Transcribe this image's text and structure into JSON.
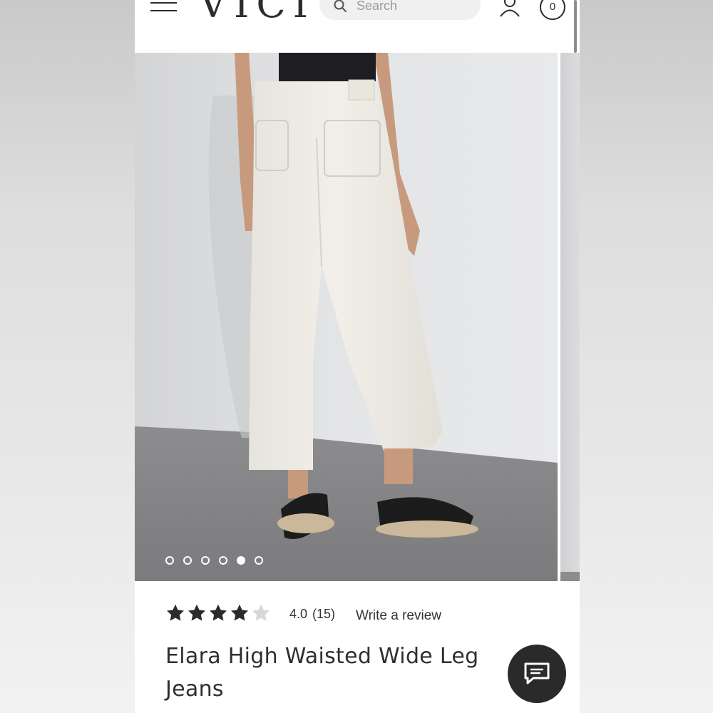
{
  "header": {
    "logo": "VICI",
    "search": {
      "placeholder": "Search"
    },
    "cart_count": "0"
  },
  "gallery": {
    "slide_count": 6,
    "active_slide": 5
  },
  "product": {
    "rating": 4.0,
    "rating_display": "4.0",
    "review_count_display": "(15)",
    "write_review_label": "Write a review",
    "title": "Elara High Waisted Wide Leg Jeans"
  },
  "colors": {
    "text": "#2f2f2f",
    "chat_button": "#2a2a2a",
    "star_filled": "#2b2b2b",
    "star_empty": "#d8d8d8"
  },
  "icons": [
    "menu-icon",
    "search-icon",
    "account-icon",
    "cart-icon",
    "star-icon",
    "chat-icon"
  ]
}
